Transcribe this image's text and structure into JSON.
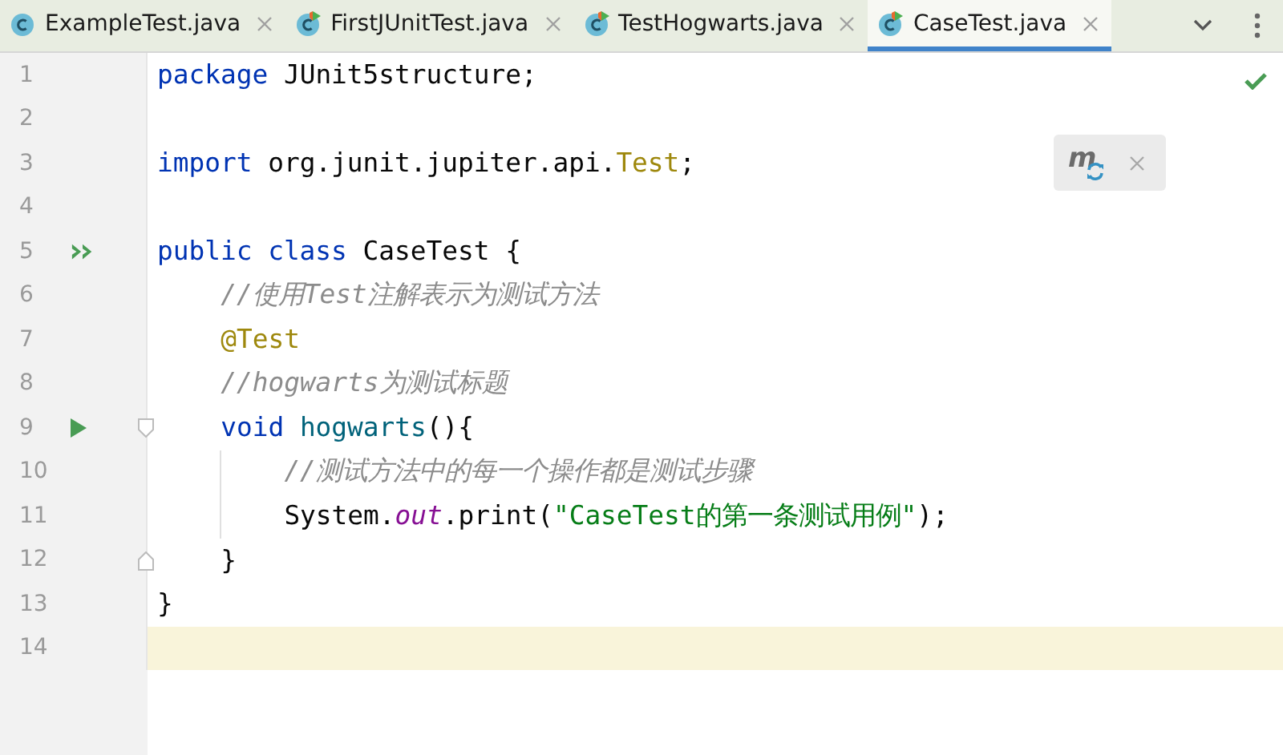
{
  "tabs": [
    {
      "label": "ExampleTest.java",
      "selected": false,
      "kind": "class"
    },
    {
      "label": "FirstJUnitTest.java",
      "selected": false,
      "kind": "runnable_class"
    },
    {
      "label": "TestHogwarts.java",
      "selected": false,
      "kind": "runnable_class"
    },
    {
      "label": "CaseTest.java",
      "selected": true,
      "kind": "runnable_class"
    }
  ],
  "inspection_ok": true,
  "popup": {
    "label": "m"
  },
  "lines": [
    {
      "number": "1",
      "current": false,
      "tokens": [
        {
          "kind": "keyword",
          "text": "package "
        },
        {
          "kind": "plain",
          "text": "JUnit5structure;"
        }
      ]
    },
    {
      "number": "2",
      "current": false
    },
    {
      "number": "3",
      "current": false,
      "tokens": [
        {
          "kind": "keyword",
          "text": "import "
        },
        {
          "kind": "plain",
          "text": "org.junit.jupiter.api."
        },
        {
          "kind": "annotation",
          "text": "Test"
        },
        {
          "kind": "plain",
          "text": ";"
        }
      ]
    },
    {
      "number": "4",
      "current": false
    },
    {
      "number": "5",
      "gutter": {
        "kind": "run_all"
      },
      "current": false,
      "tokens": [
        {
          "kind": "keyword",
          "text": "public class "
        },
        {
          "kind": "plain",
          "text": "CaseTest {"
        }
      ]
    },
    {
      "number": "6",
      "current": false,
      "tokens": [
        {
          "kind": "comment",
          "text": "//使用Test注解表示为测试方法"
        }
      ]
    },
    {
      "number": "7",
      "current": false,
      "tokens": [
        {
          "kind": "annotation",
          "text": "@Test"
        }
      ]
    },
    {
      "number": "8",
      "current": false,
      "tokens": [
        {
          "kind": "comment",
          "text": "//hogwarts为测试标题"
        }
      ]
    },
    {
      "number": "9",
      "gutter": {
        "kind": "run"
      },
      "fold": {
        "kind": "start"
      },
      "current": false,
      "tokens": [
        {
          "kind": "keyword",
          "text": "void "
        },
        {
          "kind": "method",
          "text": "hogwarts"
        },
        {
          "kind": "plain",
          "text": "(){"
        }
      ]
    },
    {
      "number": "10",
      "current": false,
      "tokens": [
        {
          "kind": "comment",
          "text": "//测试方法中的每一个操作都是测试步骤"
        }
      ]
    },
    {
      "number": "11",
      "current": false,
      "tokens": [
        {
          "kind": "plain",
          "text": "System."
        },
        {
          "kind": "static_field",
          "text": "out"
        },
        {
          "kind": "plain",
          "text": ".print("
        },
        {
          "kind": "string",
          "text": "\"CaseTest的第一条测试用例\""
        },
        {
          "kind": "plain",
          "text": ");"
        }
      ]
    },
    {
      "number": "12",
      "fold": {
        "kind": "end"
      },
      "current": false,
      "tokens": [
        {
          "kind": "plain",
          "text": "}"
        }
      ]
    },
    {
      "number": "13",
      "current": false,
      "tokens": [
        {
          "kind": "plain",
          "text": "}"
        }
      ]
    },
    {
      "number": "14",
      "current": true
    }
  ]
}
